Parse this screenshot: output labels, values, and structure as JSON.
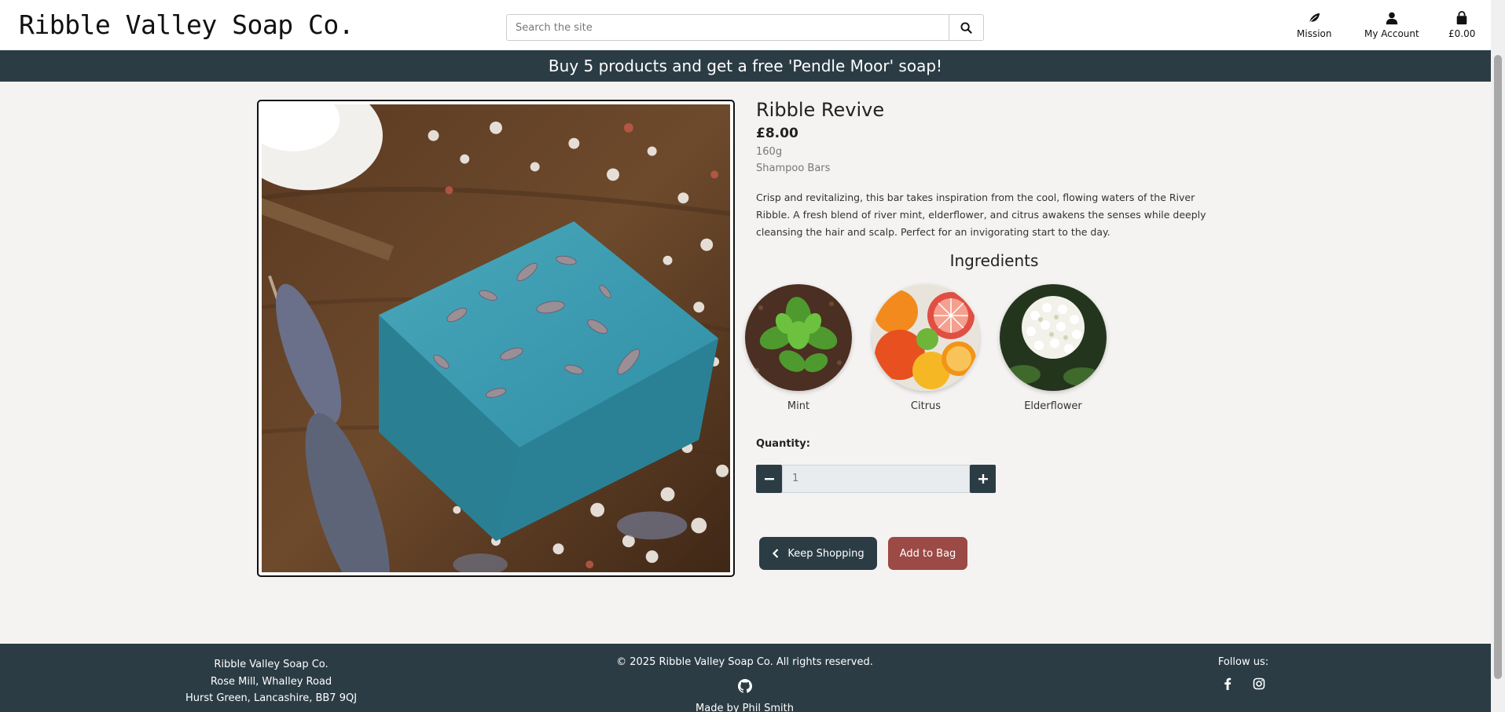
{
  "header": {
    "logo": "Ribble Valley Soap Co.",
    "search_placeholder": "Search the site",
    "nav": {
      "mission": "Mission",
      "account": "My Account",
      "bag_total": "£0.00"
    }
  },
  "banner": {
    "text": "Buy 5 products and get a free 'Pendle Moor' soap!"
  },
  "product": {
    "name": "Ribble Revive",
    "price": "£8.00",
    "weight": "160g",
    "category": "Shampoo Bars",
    "description": "Crisp and revitalizing, this bar takes inspiration from the cool, flowing waters of the River Ribble. A fresh blend of river mint, elderflower, and citrus awakens the senses while deeply cleansing the hair and scalp. Perfect for an invigorating start to the day.",
    "ingredients_heading": "Ingredients",
    "ingredients": [
      {
        "name": "Mint"
      },
      {
        "name": "Citrus"
      },
      {
        "name": "Elderflower"
      }
    ],
    "quantity_label": "Quantity:",
    "quantity_value": "1",
    "keep_shopping": "Keep Shopping",
    "add_to_bag": "Add to Bag"
  },
  "footer": {
    "address": [
      "Ribble Valley Soap Co.",
      "Rose Mill, Whalley Road",
      "Hurst Green, Lancashire, BB7 9QJ"
    ],
    "copyright": "© 2025 Ribble Valley Soap Co. All rights reserved.",
    "made_by": "Made by Phil Smith",
    "follow": "Follow us:"
  },
  "colors": {
    "dark": "#2b3c45",
    "accent": "#9b4a45",
    "background": "#f5f3f1"
  }
}
